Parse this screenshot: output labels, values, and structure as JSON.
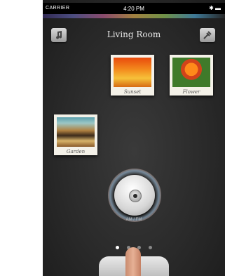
{
  "status_bar": {
    "carrier": "CARRIER",
    "time": "4:20 PM",
    "icons": "✱ ▬"
  },
  "header": {
    "title": "Living Room",
    "left_icon": "music-icon",
    "right_icon": "settings-icon"
  },
  "photos": [
    {
      "caption": "Sunset"
    },
    {
      "caption": "Flower"
    },
    {
      "caption": "Garden"
    }
  ],
  "dial": {
    "label": "AM / FM"
  },
  "page_indicator": {
    "count": 4,
    "active": 0
  }
}
